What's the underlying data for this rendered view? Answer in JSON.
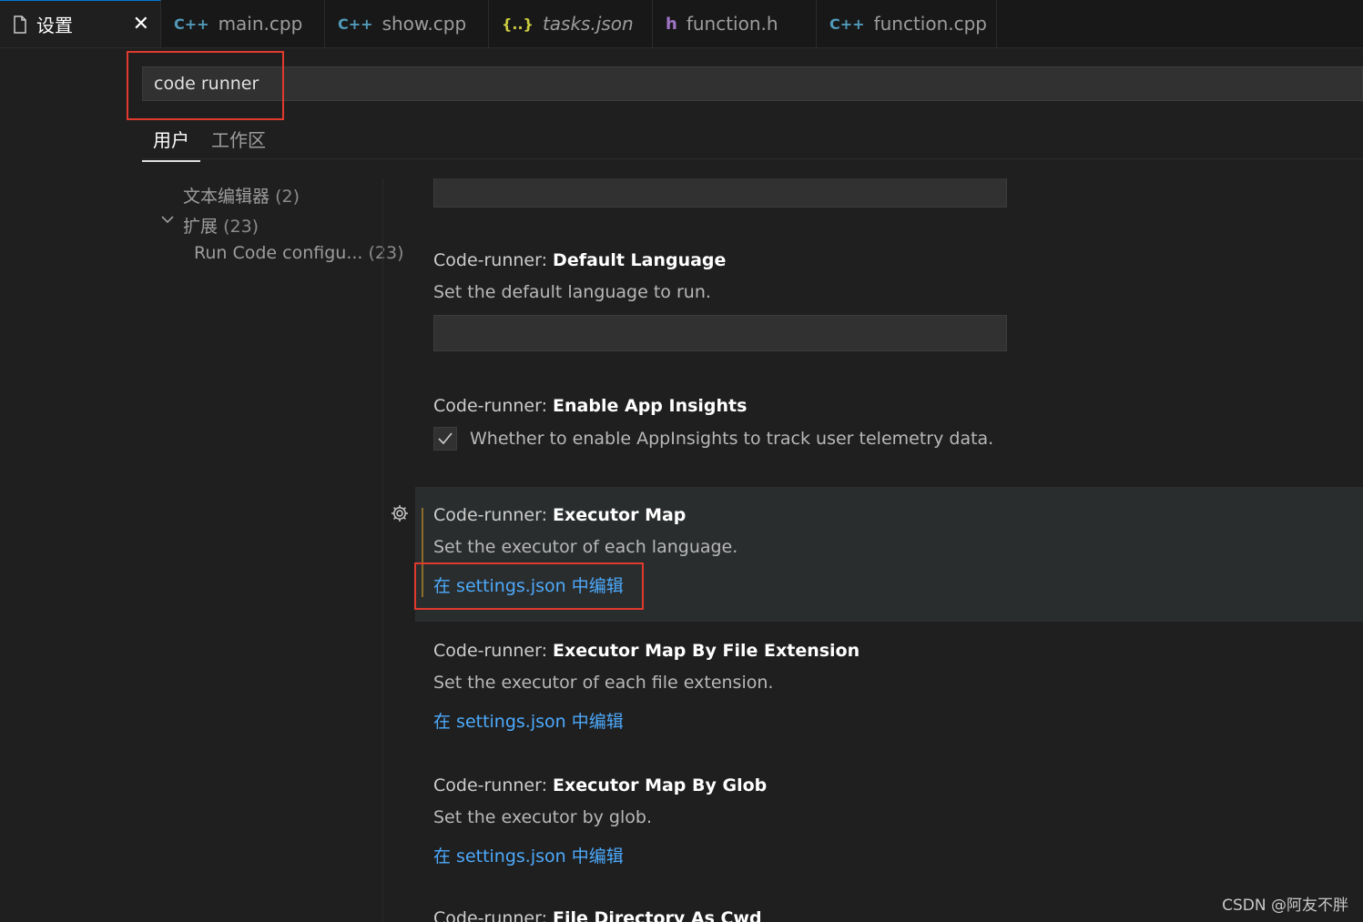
{
  "tabs": [
    {
      "label": "设置",
      "icon": "file-icon",
      "active": true
    },
    {
      "label": "main.cpp",
      "icon": "cpp-icon"
    },
    {
      "label": "show.cpp",
      "icon": "cpp-icon"
    },
    {
      "label": "tasks.json",
      "icon": "json-icon",
      "italic": true
    },
    {
      "label": "function.h",
      "icon": "header-icon"
    },
    {
      "label": "function.cpp",
      "icon": "cpp-icon"
    }
  ],
  "tab_icons": {
    "cpp": "C++",
    "json": "{..}",
    "h": "h",
    "close": "✕"
  },
  "search": {
    "value": "code runner"
  },
  "scope_tabs": {
    "user": "用户",
    "workspace": "工作区"
  },
  "toc": {
    "text_editor": "文本编辑器",
    "text_editor_count": "(2)",
    "extensions": "扩展",
    "extensions_count": "(23)",
    "run_code": "Run Code configu...",
    "run_code_count": "(23)"
  },
  "settings": [
    {
      "category": "Code-runner: ",
      "name": "Default Language",
      "description": "Set the default language to run."
    },
    {
      "category": "Code-runner: ",
      "name": "Enable App Insights",
      "description": "Whether to enable AppInsights to track user telemetry data.",
      "checked": true
    },
    {
      "category": "Code-runner: ",
      "name": "Executor Map",
      "description": "Set the executor of each language.",
      "link": "在 settings.json 中编辑"
    },
    {
      "category": "Code-runner: ",
      "name": "Executor Map By File Extension",
      "description": "Set the executor of each file extension.",
      "link": "在 settings.json 中编辑"
    },
    {
      "category": "Code-runner: ",
      "name": "Executor Map By Glob",
      "description": "Set the executor by glob.",
      "link": "在 settings.json 中编辑"
    },
    {
      "category": "Code-runner: ",
      "name": "File Directory As Cwd"
    }
  ],
  "watermark": "CSDN @阿友不胖",
  "colors": {
    "link": "#4daafc",
    "highlight_border": "#e03a2e",
    "cpp_icon": "#519aba"
  }
}
